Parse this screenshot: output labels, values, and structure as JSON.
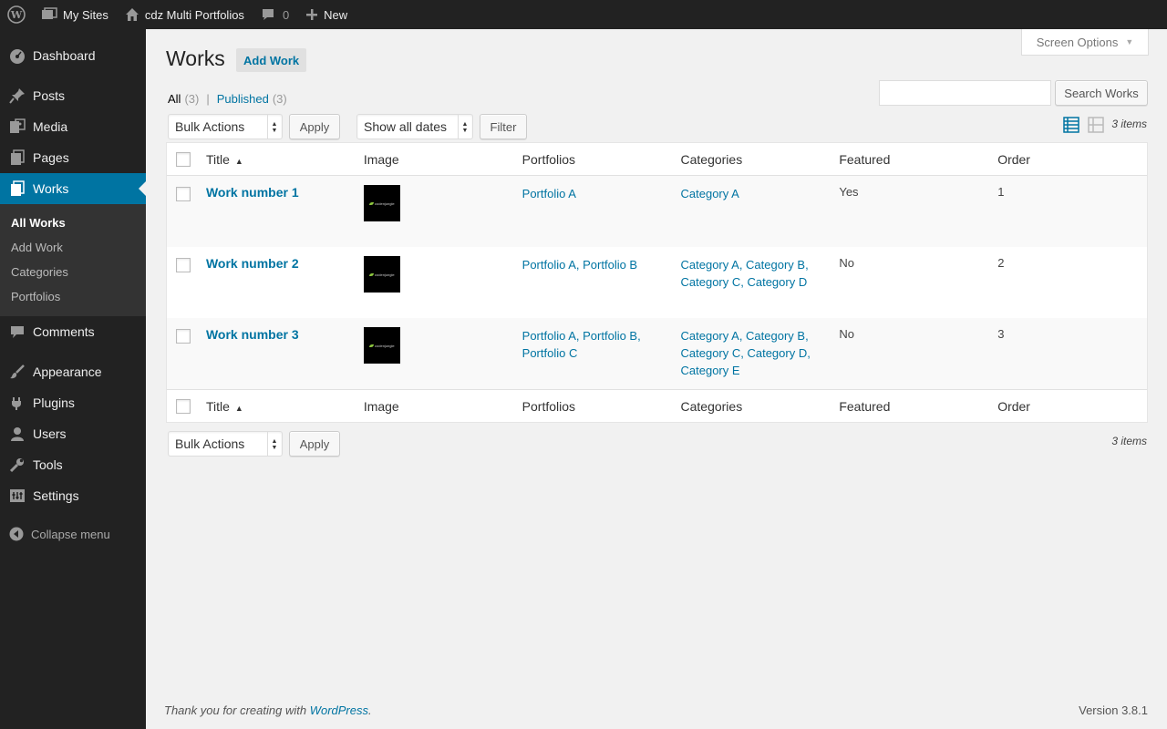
{
  "adminbar": {
    "my_sites": "My Sites",
    "site_name": "cdz Multi Portfolios",
    "comments_count": "0",
    "new_label": "New"
  },
  "sidebar": {
    "items": [
      {
        "label": "Dashboard",
        "icon": "dashboard-icon"
      },
      {
        "label": "Posts",
        "icon": "pin-icon"
      },
      {
        "label": "Media",
        "icon": "media-icon"
      },
      {
        "label": "Pages",
        "icon": "pages-icon"
      },
      {
        "label": "Works",
        "icon": "works-icon"
      },
      {
        "label": "Comments",
        "icon": "comment-icon"
      },
      {
        "label": "Appearance",
        "icon": "brush-icon"
      },
      {
        "label": "Plugins",
        "icon": "plug-icon"
      },
      {
        "label": "Users",
        "icon": "user-icon"
      },
      {
        "label": "Tools",
        "icon": "wrench-icon"
      },
      {
        "label": "Settings",
        "icon": "settings-icon"
      }
    ],
    "submenu": [
      "All Works",
      "Add Work",
      "Categories",
      "Portfolios"
    ],
    "collapse": "Collapse menu"
  },
  "header": {
    "screen_options": "Screen Options",
    "title": "Works",
    "add_new": "Add Work"
  },
  "filters": {
    "all": "All",
    "all_count": "(3)",
    "published": "Published",
    "published_count": "(3)",
    "separator": "|"
  },
  "search": {
    "button": "Search Works",
    "value": ""
  },
  "tablenav": {
    "bulk_actions": "Bulk Actions",
    "apply": "Apply",
    "dates": "Show all dates",
    "filter": "Filter",
    "items": "3 items"
  },
  "columns": {
    "title": "Title",
    "image": "Image",
    "portfolios": "Portfolios",
    "categories": "Categories",
    "featured": "Featured",
    "order": "Order"
  },
  "rows": [
    {
      "title": "Work number 1",
      "thumb_text": "codenjungle",
      "portfolios": [
        "Portfolio A"
      ],
      "categories": [
        "Category A"
      ],
      "featured": "Yes",
      "order": "1"
    },
    {
      "title": "Work number 2",
      "thumb_text": "codenjungle",
      "portfolios": [
        "Portfolio A, Portfolio B"
      ],
      "categories": [
        "Category A, Category B,",
        "Category C, Category D"
      ],
      "featured": "No",
      "order": "2"
    },
    {
      "title": "Work number 3",
      "thumb_text": "codenjungle",
      "portfolios": [
        "Portfolio A, Portfolio B,",
        "Portfolio C"
      ],
      "categories": [
        "Category A, Category B,",
        "Category C, Category D,",
        "Category E"
      ],
      "featured": "No",
      "order": "3"
    }
  ],
  "footer": {
    "thanks_prefix": "Thank you for creating with",
    "wp_link": "WordPress",
    "thanks_suffix": ".",
    "version": "Version 3.8.1"
  },
  "colors": {
    "accent": "#0074a2",
    "adminbar": "#222222",
    "active_menu": "#0074a2"
  }
}
